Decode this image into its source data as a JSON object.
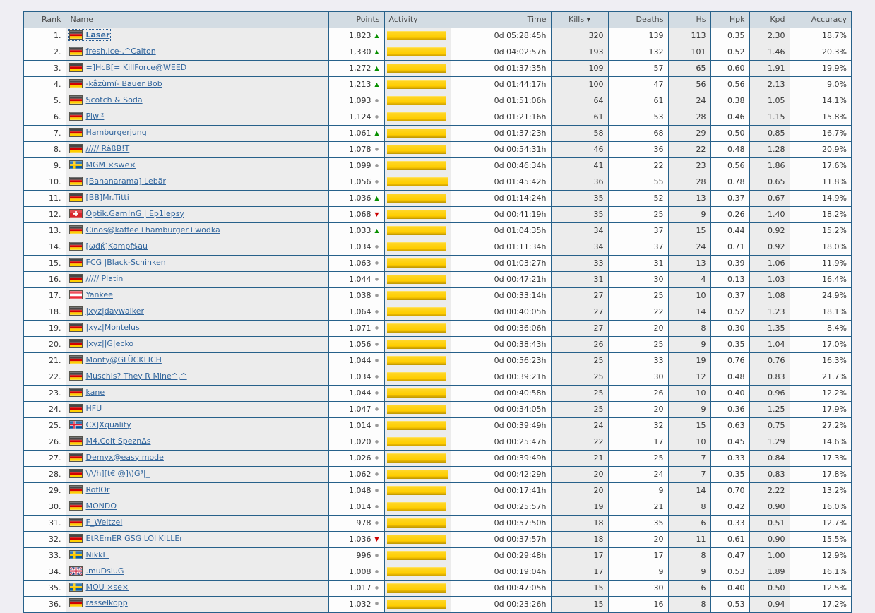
{
  "page": {
    "background": "#efeef3"
  },
  "colors": {
    "table_border": "#27618a",
    "header_bg": "#d3dce3",
    "stripe_bg": "#ececec",
    "link": "#31659c",
    "activity_bar": "#fecd00",
    "trend_up": "#089000",
    "trend_down": "#cc0000",
    "trend_steady": "#9a9a9a"
  },
  "icons": {
    "up": "▲",
    "down": "▼",
    "steady": "●",
    "sort_desc": "▼"
  },
  "table": {
    "headers": {
      "rank": "Rank",
      "name": "Name",
      "points": "Points",
      "activity": "Activity",
      "time": "Time",
      "kills": "Kills",
      "deaths": "Deaths",
      "hs": "Hs",
      "hpk": "Hpk",
      "kpd": "Kpd",
      "accuracy": "Accuracy"
    },
    "sorted_by": "kills",
    "rows": [
      {
        "rank": "1.",
        "flag": "de",
        "name": "Laser",
        "highlight": true,
        "points": "1,823",
        "trend": "up",
        "activity_pct": 97,
        "time": "0d 05:28:45h",
        "kills": "320",
        "deaths": "139",
        "hs": "113",
        "hpk": "0.35",
        "kpd": "2.30",
        "accuracy": "18.7%"
      },
      {
        "rank": "2.",
        "flag": "de",
        "name": "fresh.ice-.^Calton",
        "points": "1,330",
        "trend": "up",
        "activity_pct": 97,
        "time": "0d 04:02:57h",
        "kills": "193",
        "deaths": "132",
        "hs": "101",
        "hpk": "0.52",
        "kpd": "1.46",
        "accuracy": "20.3%"
      },
      {
        "rank": "3.",
        "flag": "de",
        "name": "=]HcB[= KillForce@WEED",
        "points": "1,272",
        "trend": "up",
        "activity_pct": 97,
        "time": "0d 01:37:35h",
        "kills": "109",
        "deaths": "57",
        "hs": "65",
        "hpk": "0.60",
        "kpd": "1.91",
        "accuracy": "19.9%"
      },
      {
        "rank": "4.",
        "flag": "de",
        "name": "-kåzùmí- Bauer Bob",
        "points": "1,213",
        "trend": "up",
        "activity_pct": 97,
        "time": "0d 01:44:17h",
        "kills": "100",
        "deaths": "47",
        "hs": "56",
        "hpk": "0.56",
        "kpd": "2.13",
        "accuracy": "9.0%"
      },
      {
        "rank": "5.",
        "flag": "de",
        "name": "Scotch & Soda",
        "points": "1,093",
        "trend": "steady",
        "activity_pct": 97,
        "time": "0d 01:51:06h",
        "kills": "64",
        "deaths": "61",
        "hs": "24",
        "hpk": "0.38",
        "kpd": "1.05",
        "accuracy": "14.1%"
      },
      {
        "rank": "6.",
        "flag": "de",
        "name": "Piwi²",
        "points": "1,124",
        "trend": "steady",
        "activity_pct": 97,
        "time": "0d 01:21:16h",
        "kills": "61",
        "deaths": "53",
        "hs": "28",
        "hpk": "0.46",
        "kpd": "1.15",
        "accuracy": "15.8%"
      },
      {
        "rank": "7.",
        "flag": "de",
        "name": "Hamburgerjung",
        "points": "1,061",
        "trend": "up",
        "activity_pct": 97,
        "time": "0d 01:37:23h",
        "kills": "58",
        "deaths": "68",
        "hs": "29",
        "hpk": "0.50",
        "kpd": "0.85",
        "accuracy": "16.7%"
      },
      {
        "rank": "8.",
        "flag": "de",
        "name": "///// RàßB!T",
        "points": "1,078",
        "trend": "steady",
        "activity_pct": 97,
        "time": "0d 00:54:31h",
        "kills": "46",
        "deaths": "36",
        "hs": "22",
        "hpk": "0.48",
        "kpd": "1.28",
        "accuracy": "20.9%"
      },
      {
        "rank": "9.",
        "flag": "se",
        "name": "MGM ×swe×",
        "points": "1,099",
        "trend": "steady",
        "activity_pct": 97,
        "time": "0d 00:46:34h",
        "kills": "41",
        "deaths": "22",
        "hs": "23",
        "hpk": "0.56",
        "kpd": "1.86",
        "accuracy": "17.6%"
      },
      {
        "rank": "10.",
        "flag": "de",
        "name": "[Bananarama] Lebär",
        "points": "1,056",
        "trend": "steady",
        "activity_pct": 100,
        "time": "0d 01:45:42h",
        "kills": "36",
        "deaths": "55",
        "hs": "28",
        "hpk": "0.78",
        "kpd": "0.65",
        "accuracy": "11.8%"
      },
      {
        "rank": "11.",
        "flag": "de",
        "name": "[BB]Mr.Titti",
        "points": "1,036",
        "trend": "up",
        "activity_pct": 97,
        "time": "0d 01:14:24h",
        "kills": "35",
        "deaths": "52",
        "hs": "13",
        "hpk": "0.37",
        "kpd": "0.67",
        "accuracy": "14.9%"
      },
      {
        "rank": "12.",
        "flag": "ch",
        "name": "Optik.Gam!nG | Ep1lepsy",
        "points": "1,068",
        "trend": "down",
        "activity_pct": 97,
        "time": "0d 00:41:19h",
        "kills": "35",
        "deaths": "25",
        "hs": "9",
        "hpk": "0.26",
        "kpd": "1.40",
        "accuracy": "18.2%"
      },
      {
        "rank": "13.",
        "flag": "de",
        "name": "Cinos@kaffee+hamburger+wodka",
        "points": "1,033",
        "trend": "up",
        "activity_pct": 97,
        "time": "0d 01:04:35h",
        "kills": "34",
        "deaths": "37",
        "hs": "15",
        "hpk": "0.44",
        "kpd": "0.92",
        "accuracy": "15.2%"
      },
      {
        "rank": "14.",
        "flag": "de",
        "name": "[ωđќ]Kampf$au",
        "points": "1,034",
        "trend": "steady",
        "activity_pct": 97,
        "time": "0d 01:11:34h",
        "kills": "34",
        "deaths": "37",
        "hs": "24",
        "hpk": "0.71",
        "kpd": "0.92",
        "accuracy": "18.0%"
      },
      {
        "rank": "15.",
        "flag": "de",
        "name": "FCG |Black-Schinken",
        "points": "1,063",
        "trend": "steady",
        "activity_pct": 97,
        "time": "0d 01:03:27h",
        "kills": "33",
        "deaths": "31",
        "hs": "13",
        "hpk": "0.39",
        "kpd": "1.06",
        "accuracy": "11.9%"
      },
      {
        "rank": "16.",
        "flag": "de",
        "name": "///// Platin",
        "points": "1,044",
        "trend": "steady",
        "activity_pct": 97,
        "time": "0d 00:47:21h",
        "kills": "31",
        "deaths": "30",
        "hs": "4",
        "hpk": "0.13",
        "kpd": "1.03",
        "accuracy": "16.4%"
      },
      {
        "rank": "17.",
        "flag": "at",
        "name": "Yankee",
        "points": "1,038",
        "trend": "steady",
        "activity_pct": 97,
        "time": "0d 00:33:14h",
        "kills": "27",
        "deaths": "25",
        "hs": "10",
        "hpk": "0.37",
        "kpd": "1.08",
        "accuracy": "24.9%"
      },
      {
        "rank": "18.",
        "flag": "de",
        "name": "|xyz|daywalker",
        "points": "1,064",
        "trend": "steady",
        "activity_pct": 97,
        "time": "0d 00:40:05h",
        "kills": "27",
        "deaths": "22",
        "hs": "14",
        "hpk": "0.52",
        "kpd": "1.23",
        "accuracy": "18.1%"
      },
      {
        "rank": "19.",
        "flag": "de",
        "name": "|xyz|Montelus",
        "points": "1,071",
        "trend": "steady",
        "activity_pct": 97,
        "time": "0d 00:36:06h",
        "kills": "27",
        "deaths": "20",
        "hs": "8",
        "hpk": "0.30",
        "kpd": "1.35",
        "accuracy": "8.4%"
      },
      {
        "rank": "20.",
        "flag": "de",
        "name": "|xyz||G|ecko",
        "points": "1,056",
        "trend": "steady",
        "activity_pct": 97,
        "time": "0d 00:38:43h",
        "kills": "26",
        "deaths": "25",
        "hs": "9",
        "hpk": "0.35",
        "kpd": "1.04",
        "accuracy": "17.0%"
      },
      {
        "rank": "21.",
        "flag": "de",
        "name": "Monty@GLÜCKLICH",
        "points": "1,044",
        "trend": "steady",
        "activity_pct": 97,
        "time": "0d 00:56:23h",
        "kills": "25",
        "deaths": "33",
        "hs": "19",
        "hpk": "0.76",
        "kpd": "0.76",
        "accuracy": "16.3%"
      },
      {
        "rank": "22.",
        "flag": "de",
        "name": "Muschis? They R Mine^,^",
        "points": "1,034",
        "trend": "steady",
        "activity_pct": 97,
        "time": "0d 00:39:21h",
        "kills": "25",
        "deaths": "30",
        "hs": "12",
        "hpk": "0.48",
        "kpd": "0.83",
        "accuracy": "21.7%"
      },
      {
        "rank": "23.",
        "flag": "de",
        "name": "kane",
        "points": "1,044",
        "trend": "steady",
        "activity_pct": 97,
        "time": "0d 00:40:58h",
        "kills": "25",
        "deaths": "26",
        "hs": "10",
        "hpk": "0.40",
        "kpd": "0.96",
        "accuracy": "12.2%"
      },
      {
        "rank": "24.",
        "flag": "de",
        "name": "HFU",
        "points": "1,047",
        "trend": "steady",
        "activity_pct": 97,
        "time": "0d 00:34:05h",
        "kills": "25",
        "deaths": "20",
        "hs": "9",
        "hpk": "0.36",
        "kpd": "1.25",
        "accuracy": "17.9%"
      },
      {
        "rank": "25.",
        "flag": "is",
        "name": "CX|Xquality",
        "points": "1,014",
        "trend": "steady",
        "activity_pct": 97,
        "time": "0d 00:39:49h",
        "kills": "24",
        "deaths": "32",
        "hs": "15",
        "hpk": "0.63",
        "kpd": "0.75",
        "accuracy": "27.2%"
      },
      {
        "rank": "26.",
        "flag": "de",
        "name": "M4.Colt SpeznΔs",
        "points": "1,020",
        "trend": "steady",
        "activity_pct": 97,
        "time": "0d 00:25:47h",
        "kills": "22",
        "deaths": "17",
        "hs": "10",
        "hpk": "0.45",
        "kpd": "1.29",
        "accuracy": "14.6%"
      },
      {
        "rank": "27.",
        "flag": "de",
        "name": "Demyx@easy mode",
        "points": "1,026",
        "trend": "steady",
        "activity_pct": 97,
        "time": "0d 00:39:49h",
        "kills": "21",
        "deaths": "25",
        "hs": "7",
        "hpk": "0.33",
        "kpd": "0.84",
        "accuracy": "17.3%"
      },
      {
        "rank": "28.",
        "flag": "de",
        "name": "\\/\\/h][t€ @]\\)G³|_",
        "points": "1,062",
        "trend": "steady",
        "activity_pct": 100,
        "time": "0d 00:42:29h",
        "kills": "20",
        "deaths": "24",
        "hs": "7",
        "hpk": "0.35",
        "kpd": "0.83",
        "accuracy": "17.8%"
      },
      {
        "rank": "29.",
        "flag": "de",
        "name": "RoflOr",
        "points": "1,048",
        "trend": "steady",
        "activity_pct": 97,
        "time": "0d 00:17:41h",
        "kills": "20",
        "deaths": "9",
        "hs": "14",
        "hpk": "0.70",
        "kpd": "2.22",
        "accuracy": "13.2%"
      },
      {
        "rank": "30.",
        "flag": "de",
        "name": "MONDO",
        "points": "1,014",
        "trend": "steady",
        "activity_pct": 97,
        "time": "0d 00:25:57h",
        "kills": "19",
        "deaths": "21",
        "hs": "8",
        "hpk": "0.42",
        "kpd": "0.90",
        "accuracy": "16.0%"
      },
      {
        "rank": "31.",
        "flag": "de",
        "name": "F_Weitzel",
        "points": "978",
        "trend": "steady",
        "activity_pct": 97,
        "time": "0d 00:57:50h",
        "kills": "18",
        "deaths": "35",
        "hs": "6",
        "hpk": "0.33",
        "kpd": "0.51",
        "accuracy": "12.7%"
      },
      {
        "rank": "32.",
        "flag": "de",
        "name": "EtREmER GSG LOl KILLEr",
        "points": "1,036",
        "trend": "down",
        "activity_pct": 97,
        "time": "0d 00:37:57h",
        "kills": "18",
        "deaths": "20",
        "hs": "11",
        "hpk": "0.61",
        "kpd": "0.90",
        "accuracy": "15.5%"
      },
      {
        "rank": "33.",
        "flag": "se",
        "name": "NikkI_",
        "points": "996",
        "trend": "steady",
        "activity_pct": 97,
        "time": "0d 00:29:48h",
        "kills": "17",
        "deaths": "17",
        "hs": "8",
        "hpk": "0.47",
        "kpd": "1.00",
        "accuracy": "12.9%"
      },
      {
        "rank": "34.",
        "flag": "gb",
        "name": ".muDsluG",
        "points": "1,008",
        "trend": "steady",
        "activity_pct": 97,
        "time": "0d 00:19:04h",
        "kills": "17",
        "deaths": "9",
        "hs": "9",
        "hpk": "0.53",
        "kpd": "1.89",
        "accuracy": "16.1%"
      },
      {
        "rank": "35.",
        "flag": "se",
        "name": "MOU ×se×",
        "points": "1,017",
        "trend": "steady",
        "activity_pct": 97,
        "time": "0d 00:47:05h",
        "kills": "15",
        "deaths": "30",
        "hs": "6",
        "hpk": "0.40",
        "kpd": "0.50",
        "accuracy": "12.5%"
      },
      {
        "rank": "36.",
        "flag": "de",
        "name": "rasselkopp",
        "points": "1,032",
        "trend": "steady",
        "activity_pct": 97,
        "time": "0d 00:23:26h",
        "kills": "15",
        "deaths": "16",
        "hs": "8",
        "hpk": "0.53",
        "kpd": "0.94",
        "accuracy": "17.2%"
      }
    ]
  }
}
